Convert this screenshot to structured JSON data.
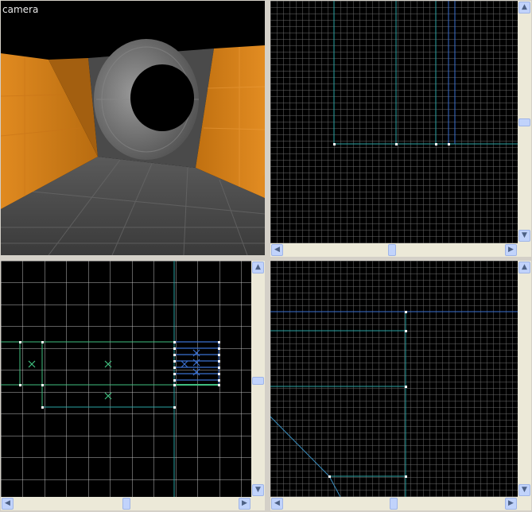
{
  "viewports": {
    "camera": {
      "label": "camera"
    },
    "top_right": {
      "label": ""
    },
    "bottom_left": {
      "label": ""
    },
    "bottom_right": {
      "label": ""
    }
  },
  "scrollbar": {
    "up_glyph": "▲",
    "down_glyph": "▼",
    "left_glyph": "◀",
    "right_glyph": "▶"
  },
  "colors": {
    "grid_minor": "#5a5a5a",
    "grid_major": "#d8d8d8",
    "brush_blue": "#3a6fd0",
    "brush_teal": "#2aa3a3",
    "brush_green": "#40c080",
    "vertex": "#ffffff",
    "wall_orange": "#d8821a",
    "floor_gray": "#555555",
    "pipe_gray": "#7a7a7a"
  }
}
